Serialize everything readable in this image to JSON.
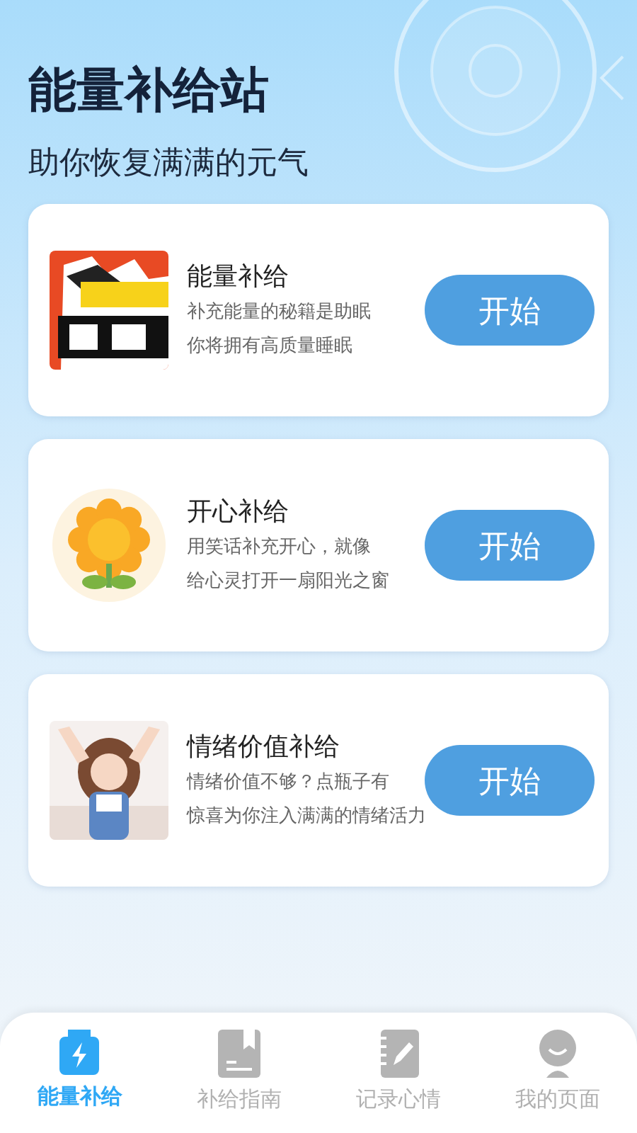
{
  "header": {
    "title": "能量补给站",
    "subtitle": "助你恢复满满的元气"
  },
  "cards": [
    {
      "title": "能量补给",
      "lines": [
        "补充能量的秘籍是助眠",
        "你将拥有高质量睡眠"
      ],
      "button": "开始"
    },
    {
      "title": "开心补给",
      "lines": [
        "用笑话补充开心，就像",
        "给心灵打开一扇阳光之窗"
      ],
      "button": "开始"
    },
    {
      "title": "情绪价值补给",
      "lines": [
        "情绪价值不够？点瓶子有",
        "惊喜为你注入满满的情绪活力"
      ],
      "button": "开始"
    }
  ],
  "tab_bar": [
    {
      "label": "能量补给",
      "selected": true
    },
    {
      "label": "补给指南",
      "selected": false
    },
    {
      "label": "记录心情",
      "selected": false
    },
    {
      "label": "我的页面",
      "selected": false
    }
  ]
}
